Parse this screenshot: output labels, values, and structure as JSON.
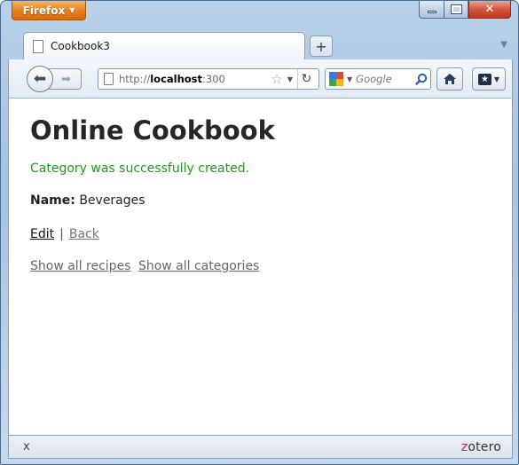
{
  "browser": {
    "menu_button_label": "Firefox",
    "tab_title": "Cookbook3",
    "newtab_label": "+",
    "url_prefix": "http://",
    "url_host": "localhost",
    "url_rest": ":300",
    "search_placeholder": "Google",
    "close_addon_bar": "x"
  },
  "addon": {
    "zotero_first_letter": "z",
    "zotero_rest": "otero"
  },
  "page": {
    "title": "Online Cookbook",
    "notice": "Category was successfully created.",
    "name_label": "Name:",
    "name_value": "Beverages",
    "edit_link": "Edit",
    "separator": "|",
    "back_link": "Back",
    "show_all_recipes": "Show all recipes",
    "show_all_categories": "Show all categories"
  },
  "colors": {
    "notice": "#1f9a1f",
    "firefox_orange": "#e7821f",
    "close_red": "#c0381f"
  },
  "icons": [
    "page-icon",
    "back-arrow-icon",
    "forward-arrow-icon",
    "star-icon",
    "reload-icon",
    "google-icon",
    "magnifier-icon",
    "home-icon",
    "zotero-icon",
    "close-icon",
    "minimize-icon",
    "maximize-icon"
  ]
}
